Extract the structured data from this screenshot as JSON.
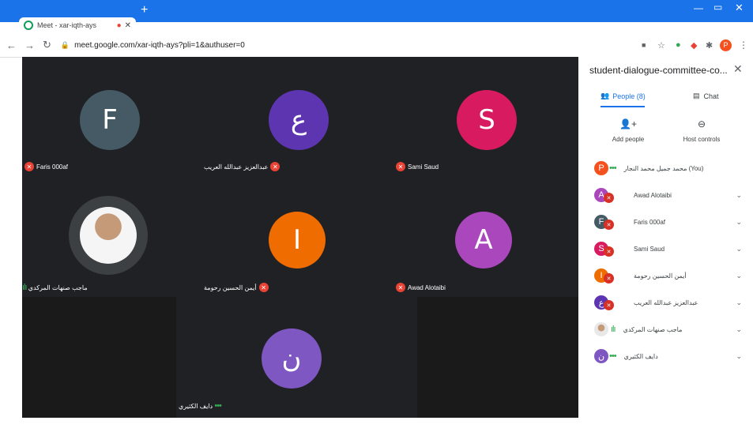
{
  "browser": {
    "tab_title": "Meet - xar-iqth-ays",
    "address": "meet.google.com/xar-iqth-ays?pli=1&authuser=0",
    "profile_letter": "P"
  },
  "tiles": [
    {
      "letter": "F",
      "color": "#455a64",
      "name": "Faris 000af"
    },
    {
      "letter": "ع",
      "color": "#5e35b1",
      "name": "عبدالعزيز عبدالله العريب"
    },
    {
      "letter": "S",
      "color": "#d81b60",
      "name": "Sami Saud"
    },
    {
      "name": "ماجب صنهات المركدي"
    },
    {
      "letter": "I",
      "color": "#ef6c00",
      "name": "أيمن الحسين رحومة"
    },
    {
      "letter": "A",
      "color": "#ab47bc",
      "name": "Awad Alotaibi"
    },
    {
      "letter": "ن",
      "color": "#7e57c2",
      "name": "دايف الكثيري"
    }
  ],
  "panel": {
    "title": "student-dialogue-committee-co...",
    "tab_people": "People (8)",
    "tab_chat": "Chat",
    "add_people": "Add people",
    "host_controls": "Host controls",
    "participants": [
      {
        "letter": "P",
        "color": "#f4511e",
        "name": "محمد جميل محمد النجار (You)"
      },
      {
        "letter": "A",
        "color": "#ab47bc",
        "name": "Awad Alotaibi"
      },
      {
        "letter": "F",
        "color": "#455a64",
        "name": "Faris 000af"
      },
      {
        "letter": "S",
        "color": "#d81b60",
        "name": "Sami Saud"
      },
      {
        "letter": "I",
        "color": "#ef6c00",
        "name": "أيمن الحسين رحومة"
      },
      {
        "letter": "ع",
        "color": "#5e35b1",
        "name": "عبدالعزيز عبدالله العريب"
      },
      {
        "letter": "",
        "color": "#e0e0e0",
        "name": "ماجب صنهات المركدي"
      },
      {
        "letter": "ن",
        "color": "#7e57c2",
        "name": "دايف الكثيري"
      }
    ]
  }
}
